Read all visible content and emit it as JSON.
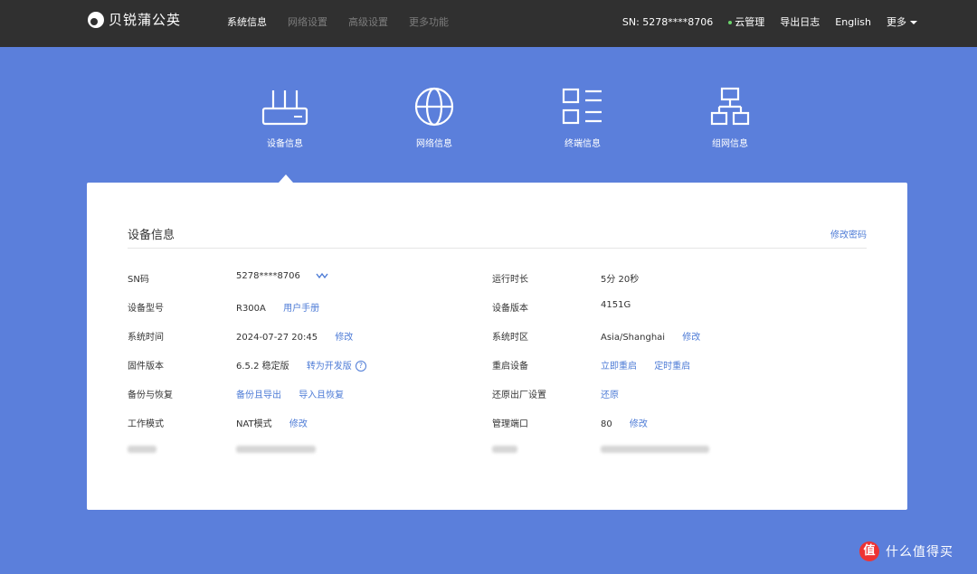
{
  "header": {
    "logo_text": "贝锐蒲公英",
    "nav": [
      "系统信息",
      "网络设置",
      "高级设置",
      "更多功能"
    ],
    "sn": "SN:  5278****8706",
    "cloud": "云管理",
    "export_log": "导出日志",
    "language": "English",
    "more": "更多"
  },
  "tabs": [
    {
      "label": "设备信息",
      "icon": "router-icon"
    },
    {
      "label": "网络信息",
      "icon": "globe-icon"
    },
    {
      "label": "终端信息",
      "icon": "list-icon"
    },
    {
      "label": "组网信息",
      "icon": "network-topology-icon"
    }
  ],
  "card": {
    "title": "设备信息",
    "change_password": "修改密码",
    "left": [
      {
        "label": "SN码",
        "value": "5278****8706"
      },
      {
        "label": "设备型号",
        "value": "R300A",
        "links": [
          "用户手册"
        ]
      },
      {
        "label": "系统时间",
        "value": "2024-07-27 20:45",
        "links": [
          "修改"
        ]
      },
      {
        "label": "固件版本",
        "value": "6.5.2 稳定版",
        "links": [
          "转为开发版"
        ]
      },
      {
        "label": "备份与恢复",
        "links": [
          "备份且导出",
          "导入且恢复"
        ]
      },
      {
        "label": "工作模式",
        "value": "NAT模式",
        "links": [
          "修改"
        ]
      }
    ],
    "right": [
      {
        "label": "运行时长",
        "value": "5分 20秒"
      },
      {
        "label": "设备版本",
        "value": "4151G"
      },
      {
        "label": "系统时区",
        "value": "Asia/Shanghai",
        "links": [
          "修改"
        ]
      },
      {
        "label": "重启设备",
        "links": [
          "立即重启",
          "定时重启"
        ]
      },
      {
        "label": "还原出厂设置",
        "links": [
          "还原"
        ]
      },
      {
        "label": "管理端口",
        "value": "80",
        "links": [
          "修改"
        ]
      }
    ]
  },
  "watermark": {
    "icon_text": "值",
    "text": "什么值得买"
  },
  "colors": {
    "background": "#5b7fdb",
    "topbar": "#303030",
    "link": "#4d7bd6"
  }
}
